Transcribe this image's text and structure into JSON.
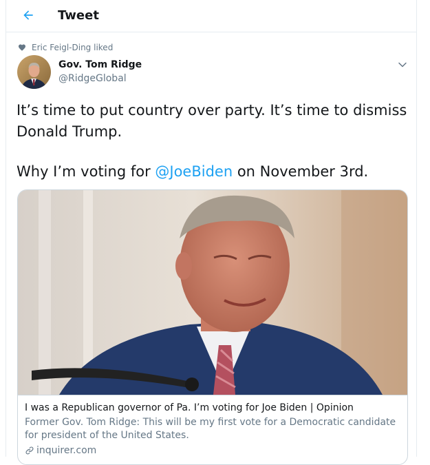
{
  "header": {
    "title": "Tweet"
  },
  "social_context": {
    "text": "Eric Feigl-Ding liked"
  },
  "author": {
    "name": "Gov. Tom Ridge",
    "handle": "@RidgeGlobal"
  },
  "tweet": {
    "line1": "It’s time to put country over party. It’s time to dismiss Donald Trump.",
    "line2_prefix": "Why I’m voting for ",
    "mention": "@JoeBiden",
    "line2_suffix": " on November 3rd."
  },
  "card": {
    "title": "I was a Republican governor of Pa. I’m voting for Joe Biden | Opinion",
    "description": "Former Gov. Tom Ridge: This will be my first vote for a Democratic candidate for president of the United States.",
    "domain": "inquirer.com"
  },
  "icons": {
    "back": "arrow-left-icon",
    "social": "heart-icon",
    "caret": "chevron-down-icon",
    "link": "link-icon"
  },
  "colors": {
    "accent": "#1da1f2",
    "text": "#14171a",
    "secondary": "#657786",
    "border": "#ccd6dd"
  }
}
